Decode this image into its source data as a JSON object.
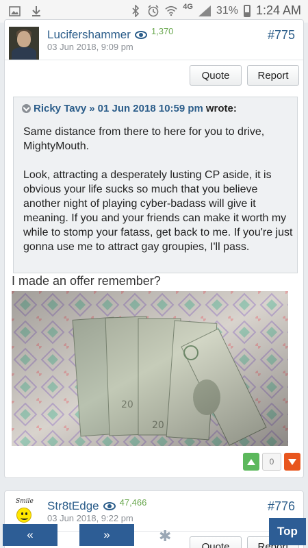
{
  "status_bar": {
    "icons": [
      "image-icon",
      "download-icon",
      "bluetooth-icon",
      "alarm-icon",
      "wifi-icon",
      "signal-icon"
    ],
    "network": "4G",
    "battery": "31%",
    "battery_level": 0.31,
    "time": "1:24 AM"
  },
  "post1": {
    "author": "Lucifershammer",
    "post_count": "1,370",
    "date": "03 Jun 2018, 9:09 pm",
    "number": "#775",
    "quote_label": "Quote",
    "report_label": "Report",
    "quote": {
      "author": "Ricky Tavy",
      "separator": "»",
      "date": "01 Jun 2018 10:59 pm",
      "wrote": "wrote:",
      "paragraphs": [
        "Same distance from there to here for you to drive, MightyMouth.",
        "Look, attracting a desperately lusting CP aside, it is obvious your life sucks so much that you believe another night of playing cyber-badass will give it meaning. If you and your friends can make it worth my while to stomp your fatass, get back to me. If you're just gonna use me to attract gay groupies, I'll pass."
      ]
    },
    "body": "I made an offer remember?",
    "votes": "0",
    "colors": {
      "upvote": "#5cb85c",
      "downvote": "#e8561e"
    }
  },
  "post2": {
    "avatar_text": "Smile",
    "author": "Str8tEdge",
    "post_count": "47,466",
    "date": "03 Jun 2018, 9:22 pm",
    "number": "#776",
    "quote_label": "Quote",
    "report_label": "Report"
  },
  "nav": {
    "prev_label": "«",
    "next_label": "»",
    "middle_label": "✱",
    "top_label": "Top",
    "color": "#2d5d95"
  }
}
